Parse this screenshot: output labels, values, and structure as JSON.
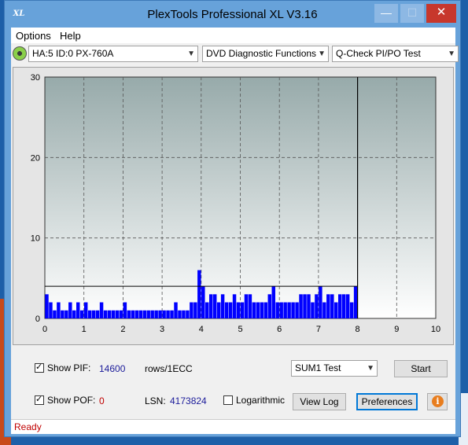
{
  "window": {
    "title": "PlexTools Professional XL V3.16",
    "icon_label": "XL",
    "minimize_glyph": "—",
    "maximize_glyph": "☐",
    "close_glyph": "✕"
  },
  "menu": {
    "options_label": "Options",
    "help_label": "Help"
  },
  "toolbar": {
    "drive": "HA:5 ID:0  PX-760A",
    "function": "DVD Diagnostic Functions",
    "test": "Q-Check PI/PO Test"
  },
  "colors": {
    "accent_window": "#67a2da",
    "series_pif": "#0000ff",
    "status_red": "#c00000"
  },
  "chart_data": {
    "type": "bar",
    "xlim": [
      0,
      10
    ],
    "ylim": [
      0,
      30
    ],
    "x_ticks": [
      "0",
      "1",
      "2",
      "3",
      "4",
      "5",
      "6",
      "7",
      "8",
      "9",
      "10"
    ],
    "y_ticks": [
      "0",
      "10",
      "20",
      "30"
    ],
    "grid": true,
    "marker_x": 8,
    "threshold_y": 4,
    "series": [
      {
        "color": "#0000ff",
        "x": [
          0.05,
          0.15,
          0.25,
          0.35,
          0.45,
          0.55,
          0.65,
          0.75,
          0.85,
          0.95,
          1.05,
          1.15,
          1.25,
          1.35,
          1.45,
          1.55,
          1.65,
          1.75,
          1.85,
          1.95,
          2.05,
          2.15,
          2.25,
          2.35,
          2.45,
          2.55,
          2.65,
          2.75,
          2.85,
          2.95,
          3.05,
          3.15,
          3.25,
          3.35,
          3.45,
          3.55,
          3.65,
          3.75,
          3.85,
          3.95,
          4.05,
          4.15,
          4.25,
          4.35,
          4.45,
          4.55,
          4.65,
          4.75,
          4.85,
          4.95,
          5.05,
          5.15,
          5.25,
          5.35,
          5.45,
          5.55,
          5.65,
          5.75,
          5.85,
          5.95,
          6.05,
          6.15,
          6.25,
          6.35,
          6.45,
          6.55,
          6.65,
          6.75,
          6.85,
          6.95,
          7.05,
          7.15,
          7.25,
          7.35,
          7.45,
          7.55,
          7.65,
          7.75,
          7.85,
          7.95
        ],
        "values": [
          3,
          2,
          1,
          2,
          1,
          1,
          2,
          1,
          2,
          1,
          2,
          1,
          1,
          1,
          2,
          1,
          1,
          1,
          1,
          1,
          2,
          1,
          1,
          1,
          1,
          1,
          1,
          1,
          1,
          1,
          1,
          1,
          1,
          2,
          1,
          1,
          1,
          2,
          2,
          6,
          4,
          2,
          3,
          3,
          2,
          3,
          2,
          2,
          3,
          2,
          2,
          3,
          3,
          2,
          2,
          2,
          2,
          3,
          4,
          2,
          2,
          2,
          2,
          2,
          2,
          3,
          3,
          3,
          2,
          3,
          4,
          2,
          3,
          3,
          2,
          3,
          3,
          3,
          2,
          4
        ]
      }
    ]
  },
  "controls": {
    "show_pif_label": "Show PIF:",
    "pif_value": "14600",
    "rows_label": "rows/1ECC",
    "sum_test": "SUM1 Test",
    "start_label": "Start",
    "show_poe_label": "Show POF:",
    "poe_value": "0",
    "lsn_label": "LSN:",
    "lsn_value": "4173824",
    "log_label": "Logarithmic",
    "viewlog_label": "View Log",
    "prefs_label": "Preferences",
    "info_glyph": "i"
  },
  "status": {
    "text": "Ready"
  }
}
